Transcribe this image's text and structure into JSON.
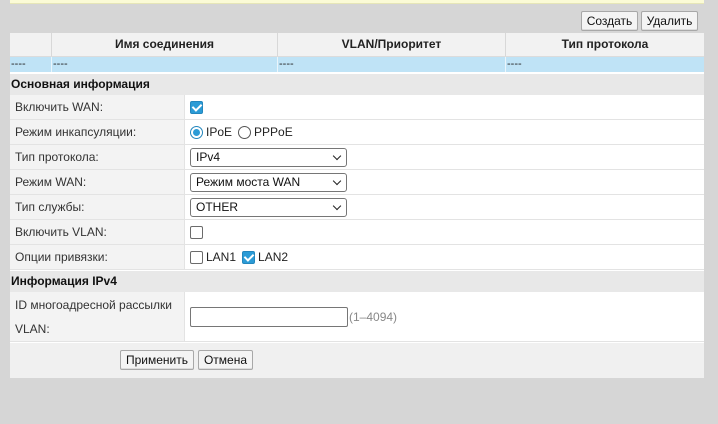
{
  "toolbar": {
    "create_label": "Создать",
    "delete_label": "Удалить"
  },
  "table": {
    "columns": [
      "",
      "Имя соединения",
      "VLAN/Приоритет",
      "Тип протокола"
    ],
    "row": [
      "----",
      "----",
      "----",
      "----"
    ]
  },
  "basic": {
    "title": "Основная информация",
    "enable_wan": {
      "label": "Включить WAN:",
      "checked": true
    },
    "encapsulation": {
      "label": "Режим инкапсуляции:",
      "options": [
        "IPoE",
        "PPPoE"
      ],
      "selected": "IPoE"
    },
    "protocol_type": {
      "label": "Тип протокола:",
      "value": "IPv4"
    },
    "wan_mode": {
      "label": "Режим WAN:",
      "value": "Режим моста WAN"
    },
    "service_type": {
      "label": "Тип службы:",
      "value": "OTHER"
    },
    "enable_vlan": {
      "label": "Включить VLAN:",
      "checked": false
    },
    "binding": {
      "label": "Опции привязки:",
      "lan1": "LAN1",
      "lan1_checked": false,
      "lan2": "LAN2",
      "lan2_checked": true
    }
  },
  "ipv4": {
    "title": "Информация IPv4",
    "multicast_label_line1": "ID многоадресной рассылки",
    "multicast_label_line2": "VLAN:",
    "multicast_value": "",
    "multicast_hint": "(1–4094)"
  },
  "actions": {
    "apply_label": "Применить",
    "cancel_label": "Отмена"
  },
  "colors": {
    "accent": "#2b9bd6",
    "row_highlight": "#bfe3f6",
    "page_bg": "#d6d6d6"
  }
}
